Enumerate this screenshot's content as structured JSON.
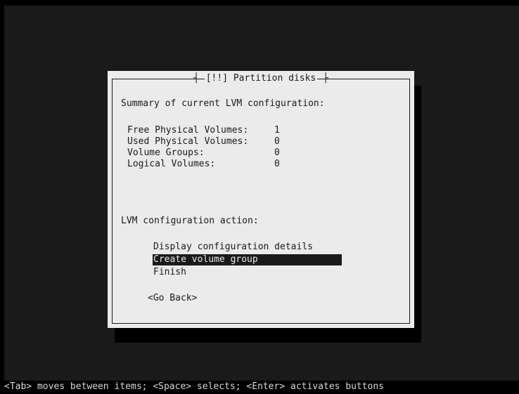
{
  "dialog": {
    "title": "[!!] Partition disks",
    "summary_heading": "Summary of current LVM configuration:",
    "summary_rows": [
      {
        "label": "Free Physical Volumes:",
        "value": "1"
      },
      {
        "label": "Used Physical Volumes:",
        "value": "0"
      },
      {
        "label": "Volume Groups:",
        "value": "0"
      },
      {
        "label": "Logical Volumes:",
        "value": "0"
      }
    ],
    "action_heading": "LVM configuration action:",
    "menu": [
      {
        "label": "Display configuration details",
        "selected": false
      },
      {
        "label": "Create volume group",
        "selected": true
      },
      {
        "label": "Finish",
        "selected": false
      }
    ],
    "go_back_label": "<Go Back>"
  },
  "helpbar": {
    "text": "<Tab> moves between items; <Space> selects; <Enter> activates buttons"
  },
  "colors": {
    "background": "#1a1a1a",
    "dialog": "#ebebeb",
    "selection": "#1a1a1a"
  }
}
